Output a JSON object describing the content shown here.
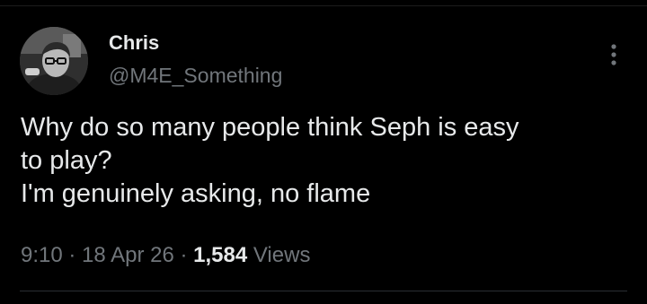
{
  "author": {
    "display_name": "Chris",
    "handle": "@M4E_Something",
    "avatar_icon": "profile-photo"
  },
  "more_icon": "more-vertical-icon",
  "tweet": {
    "text": "Why do so many people think Seph is easy\nto play?\nI'm genuinely asking, no flame"
  },
  "meta": {
    "time": "9:10",
    "separator": " · ",
    "date": "18 Apr 26",
    "view_count": "1,584",
    "views_label": "Views"
  },
  "colors": {
    "background": "#000000",
    "primary_text": "#e7e9ea",
    "secondary_text": "#71767b"
  }
}
